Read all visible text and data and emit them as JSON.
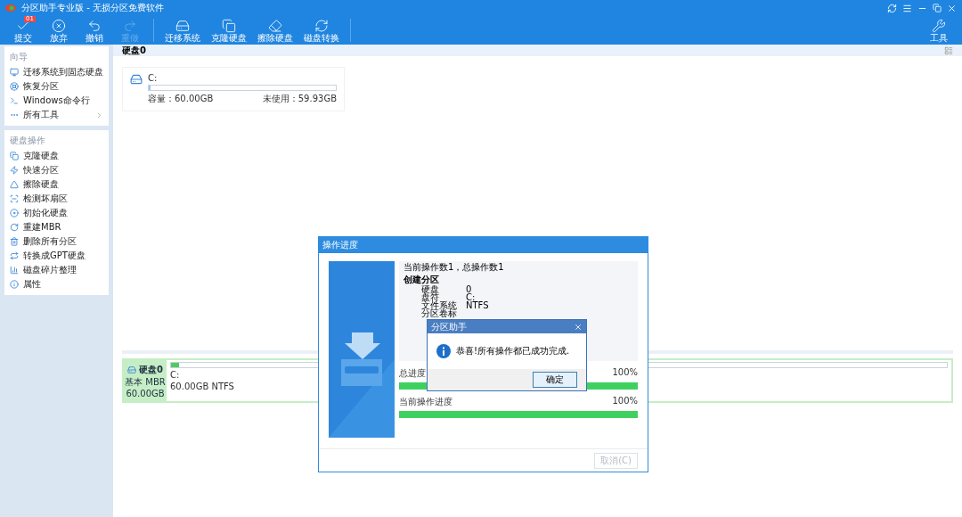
{
  "window": {
    "title": "分区助手专业版 - 无损分区免费软件"
  },
  "toolbar": {
    "buttons": [
      {
        "label": "提交",
        "disabled": false,
        "badge": "01"
      },
      {
        "label": "放弃",
        "disabled": false
      },
      {
        "label": "撤销",
        "disabled": false
      },
      {
        "label": "重做",
        "disabled": true
      },
      {
        "label": "迁移系统",
        "disabled": false
      },
      {
        "label": "克隆硬盘",
        "disabled": false
      },
      {
        "label": "擦除硬盘",
        "disabled": false
      },
      {
        "label": "磁盘转换",
        "disabled": false
      }
    ],
    "tools_button": {
      "label": "工具"
    }
  },
  "sidebar": {
    "sections": [
      {
        "title": "向导",
        "items": [
          {
            "label": "迁移系统到固态硬盘",
            "submenu": false
          },
          {
            "label": "恢复分区",
            "submenu": false
          },
          {
            "label": "Windows命令行",
            "submenu": false
          },
          {
            "label": "所有工具",
            "submenu": true
          }
        ]
      },
      {
        "title": "硬盘操作",
        "items": [
          {
            "label": "克隆硬盘",
            "submenu": false
          },
          {
            "label": "快速分区",
            "submenu": false
          },
          {
            "label": "擦除硬盘",
            "submenu": false
          },
          {
            "label": "检测坏扇区",
            "submenu": false
          },
          {
            "label": "初始化硬盘",
            "submenu": false
          },
          {
            "label": "重建MBR",
            "submenu": false
          },
          {
            "label": "删除所有分区",
            "submenu": false
          },
          {
            "label": "转换成GPT硬盘",
            "submenu": false
          },
          {
            "label": "磁盘碎片整理",
            "submenu": false
          },
          {
            "label": "属性",
            "submenu": false
          }
        ]
      }
    ]
  },
  "disk_header": {
    "title": "硬盘0"
  },
  "partition_card": {
    "name": "C:",
    "capacity": "容量：60.00GB",
    "free": "未使用：59.93GB",
    "level": 0.01
  },
  "disk_map": {
    "disk": "硬盘0",
    "type": "基本 MBR",
    "size": "60.00GB",
    "partition": {
      "name": "C:",
      "info": "60.00GB NTFS",
      "level": 0.01
    }
  },
  "progress_dialog": {
    "title": "操作进度",
    "summary": "当前操作数1，总操作数1",
    "operation": {
      "title": "创建分区",
      "rows": [
        {
          "label": "硬盘",
          "value": "0"
        },
        {
          "label": "盘符",
          "value": "C:"
        },
        {
          "label": "文件系统",
          "value": "NTFS"
        },
        {
          "label": "分区卷标"
        }
      ]
    },
    "progress": [
      {
        "label": "总进度",
        "reading": "100%",
        "level": 1
      },
      {
        "label": "当前操作进度",
        "reading": "100%",
        "level": 1
      }
    ],
    "cancel_button": {
      "label": "取消(C)",
      "disabled": true
    }
  },
  "message_box": {
    "title": "分区助手",
    "message": "恭喜!所有操作都已成功完成.",
    "ok_button": "确定"
  }
}
